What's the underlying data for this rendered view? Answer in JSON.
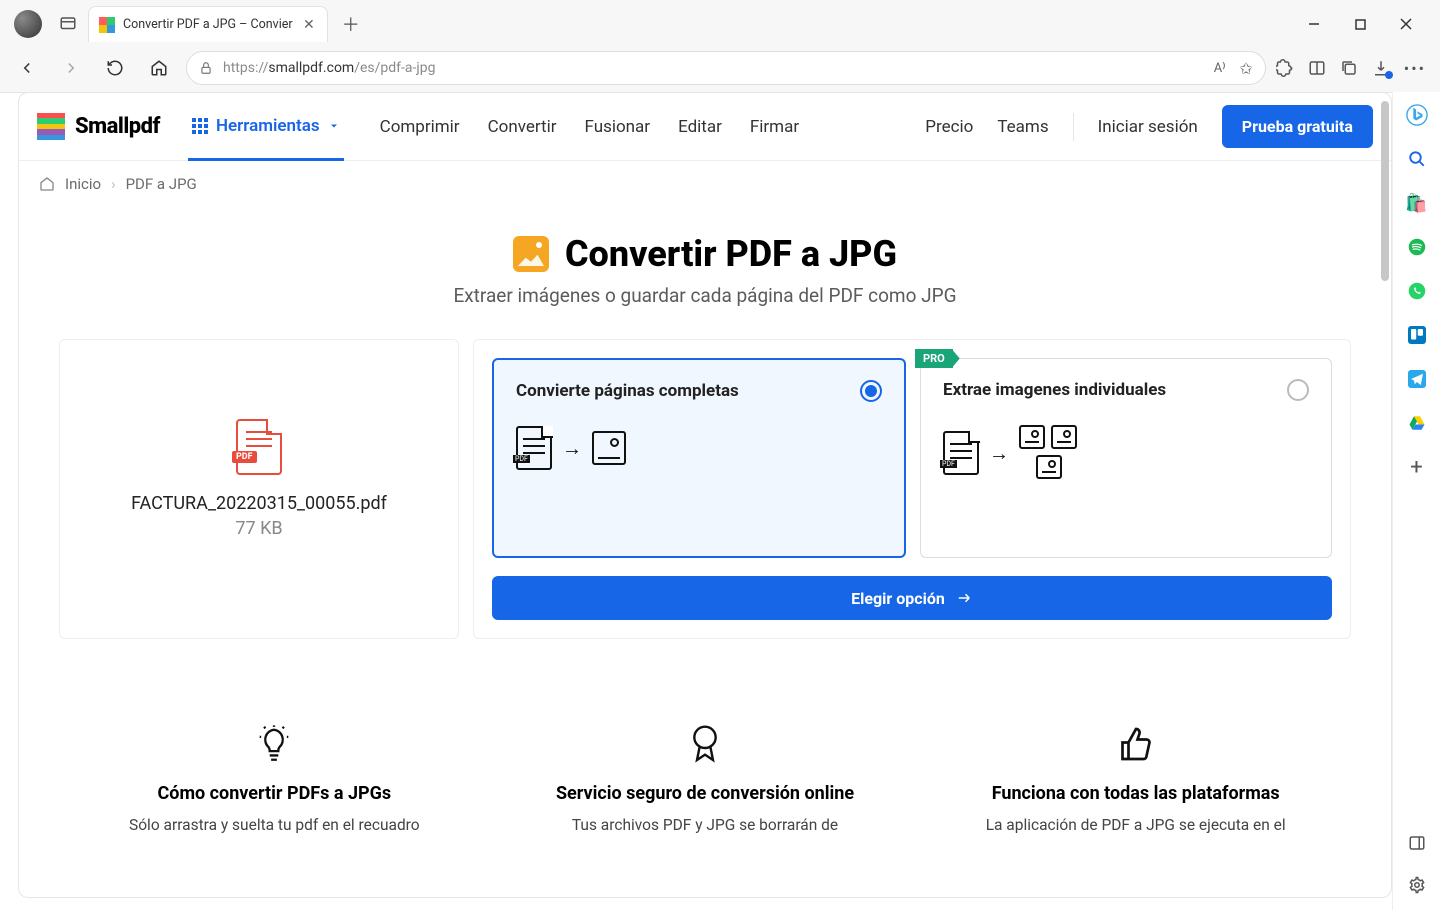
{
  "browser": {
    "tab_title": "Convertir PDF a JPG – Convier",
    "url_proto": "https://",
    "url_host": "smallpdf.com",
    "url_path": "/es/pdf-a-jpg"
  },
  "header": {
    "brand": "Smallpdf",
    "tools_label": "Herramientas",
    "nav": {
      "compress": "Comprimir",
      "convert": "Convertir",
      "merge": "Fusionar",
      "edit": "Editar",
      "sign": "Firmar"
    },
    "right": {
      "price": "Precio",
      "teams": "Teams",
      "signin": "Iniciar sesión",
      "cta": "Prueba gratuita"
    }
  },
  "breadcrumb": {
    "home": "Inicio",
    "current": "PDF a JPG"
  },
  "hero": {
    "title": "Convertir PDF a JPG",
    "subtitle": "Extraer imágenes o guardar cada página del PDF como JPG"
  },
  "file": {
    "name": "FACTURA_20220315_00055.pdf",
    "size": "77 KB",
    "badge": "PDF"
  },
  "options": {
    "convert_pages": "Convierte páginas completas",
    "extract_images": "Extrae imagenes individuales",
    "pro": "PRO",
    "choose": "Elegir opción"
  },
  "features": {
    "a": {
      "title": "Cómo convertir PDFs a JPGs",
      "body": "Sólo arrastra y suelta tu pdf en el recuadro"
    },
    "b": {
      "title": "Servicio seguro de conversión online",
      "body": "Tus archivos PDF y JPG se borrarán de"
    },
    "c": {
      "title": "Funciona con todas las plataformas",
      "body": "La aplicación de PDF a JPG se ejecuta en el"
    }
  }
}
